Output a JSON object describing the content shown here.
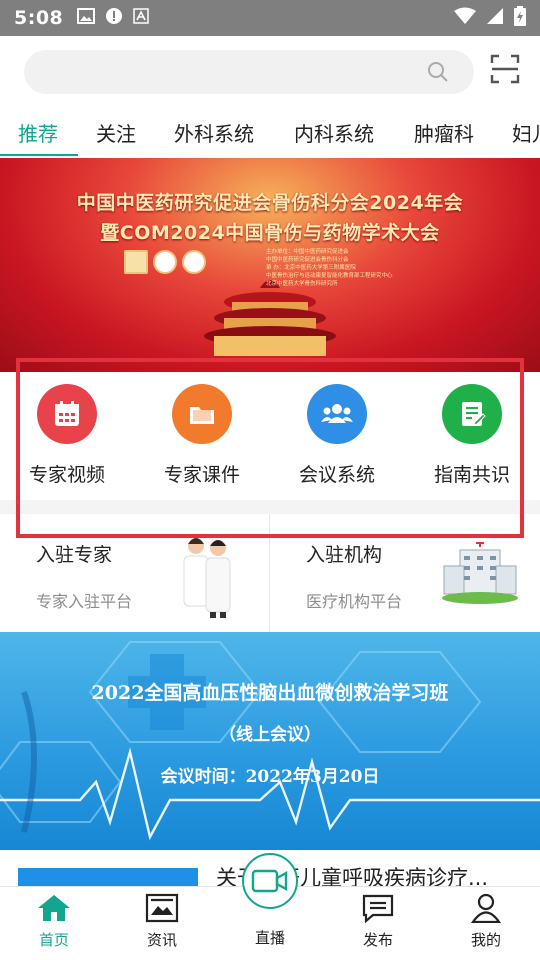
{
  "status_bar": {
    "time": "5:08"
  },
  "search": {
    "placeholder": ""
  },
  "tabs": [
    {
      "label": "推荐",
      "active": true
    },
    {
      "label": "关注"
    },
    {
      "label": "外科系统"
    },
    {
      "label": "内科系统"
    },
    {
      "label": "肿瘤科"
    },
    {
      "label": "妇儿"
    }
  ],
  "banner": {
    "title_line1": "中国中医药研究促进会骨伤科分会2024年会",
    "title_line2": "暨COM2024中国骨伤与药物学术大会",
    "organizers": [
      "主办单位：中国中医药研究促进会",
      "中国中医药研究促进会骨伤科分会",
      "承 办：北京中医药大学第三附属医院",
      "中医骨伤治疗与运动康复智能化教育部工程研究中心",
      "北京中医药大学骨伤科研究所"
    ]
  },
  "quick_actions": [
    {
      "label": "专家视频",
      "icon": "calendar-icon",
      "color": "#e8434a"
    },
    {
      "label": "专家课件",
      "icon": "folder-icon",
      "color": "#f27a2c"
    },
    {
      "label": "会议系统",
      "icon": "group-icon",
      "color": "#2f8fe6"
    },
    {
      "label": "指南共识",
      "icon": "note-icon",
      "color": "#1fb04a"
    }
  ],
  "join": [
    {
      "title": "入驻专家",
      "subtitle": "专家入驻平台"
    },
    {
      "title": "入驻机构",
      "subtitle": "医疗机构平台"
    }
  ],
  "promo": {
    "line1": "2022全国高血压性脑出血微创救治学习班",
    "line2": "（线上会议）",
    "line3": "会议时间：2022年3月20日"
  },
  "article": {
    "title": "关于召开儿童呼吸疾病诊疗..."
  },
  "bottom_nav": [
    {
      "label": "首页",
      "icon": "home-icon",
      "active": true
    },
    {
      "label": "资讯",
      "icon": "news-icon"
    },
    {
      "label": "直播",
      "icon": "video-icon"
    },
    {
      "label": "发布",
      "icon": "publish-icon"
    },
    {
      "label": "我的",
      "icon": "profile-icon"
    }
  ],
  "colors": {
    "accent": "#12a68f",
    "highlight": "#e2323d"
  }
}
